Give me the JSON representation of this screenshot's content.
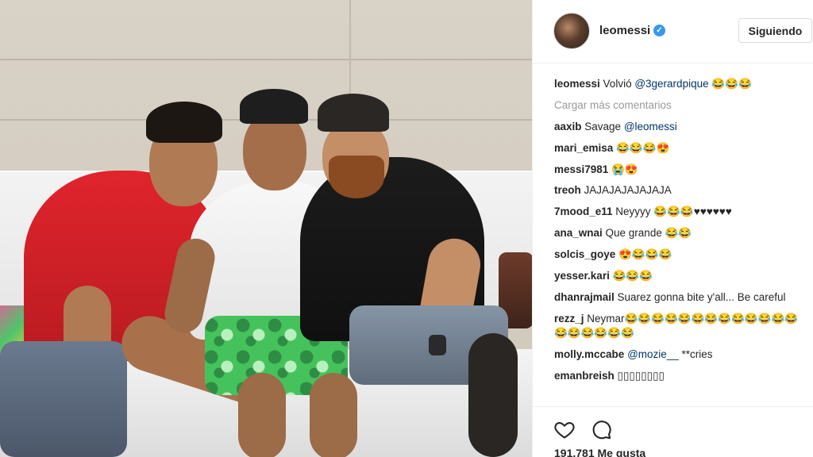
{
  "post": {
    "username": "leomessi",
    "verified_glyph": "✓",
    "follow_button": "Siguiendo",
    "likes": "191.781 Me gusta"
  },
  "comments": [
    {
      "user": "leomessi",
      "text": " Volvió ",
      "mention": "@3gerardpique",
      "after": " 😂😂😂"
    },
    {
      "user": "aaxib",
      "text": " Savage ",
      "mention": "@leomessi",
      "after": ""
    },
    {
      "user": "mari_emisa",
      "text": " 😂😂😂😍",
      "mention": "",
      "after": ""
    },
    {
      "user": "messi7981",
      "text": " 😭😍",
      "mention": "",
      "after": ""
    },
    {
      "user": "treoh",
      "text": " JAJAJAJAJAJAJA",
      "mention": "",
      "after": ""
    },
    {
      "user": "7mood_e11",
      "text": " Neyyyy 😂😂😂♥♥♥♥♥♥",
      "mention": "",
      "after": ""
    },
    {
      "user": "ana_wnai",
      "text": " Que grande 😂😂",
      "mention": "",
      "after": ""
    },
    {
      "user": "solcis_goye",
      "text": " 😍😂😂😂",
      "mention": "",
      "after": ""
    },
    {
      "user": "yesser.kari",
      "text": " 😂😂😂",
      "mention": "",
      "after": ""
    },
    {
      "user": "dhanrajmail",
      "text": " Suarez gonna bite y'all... Be careful",
      "mention": "",
      "after": ""
    },
    {
      "user": "rezz_j",
      "text": " Neymar😂😂😂😂😂😂😂😂😂😂😂😂😂😂😂😂😂😂😂",
      "mention": "",
      "after": ""
    },
    {
      "user": "molly.mccabe",
      "text": " ",
      "mention": "@mozie__",
      "after": " **cries"
    },
    {
      "user": "emanbreish",
      "text": " ▯▯▯▯▯▯▯▯",
      "mention": "",
      "after": ""
    }
  ],
  "load_more": "Cargar más comentarios",
  "icons": {
    "like": "heart-icon",
    "comment": "comment-icon",
    "verified": "verified-badge-icon",
    "avatar": "profile-avatar"
  },
  "colors": {
    "mention": "#003569",
    "verified": "#3897f0",
    "muted": "#999999",
    "text": "#262626"
  }
}
